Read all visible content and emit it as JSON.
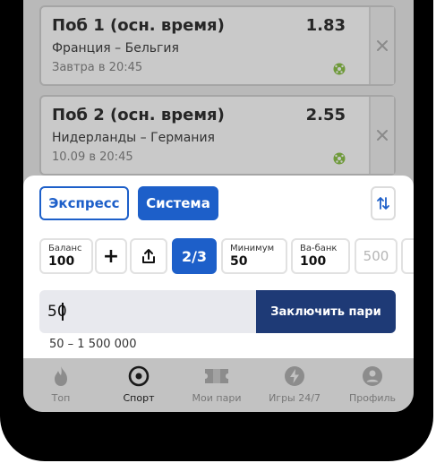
{
  "bets": [
    {
      "title": "Поб 1 (осн. время)",
      "odds": "1.83",
      "match": "Франция – Бельгия",
      "time": "Завтра в 20:45"
    },
    {
      "title": "Поб 2 (осн. время)",
      "odds": "2.55",
      "match": "Нидерланды – Германия",
      "time": "10.09 в 20:45"
    }
  ],
  "sheet": {
    "tabs": {
      "express": "Экспресс",
      "system": "Система"
    },
    "balance": {
      "label": "Баланс",
      "value": "100"
    },
    "system_option": "2/3",
    "minimum": {
      "label": "Минимум",
      "value": "50"
    },
    "vabank": {
      "label": "Ва-банк",
      "value": "100"
    },
    "preset": "500",
    "amount": {
      "value": "50"
    },
    "place_button": "Заключить пари",
    "range": "50 – 1 500 000"
  },
  "tabbar": {
    "items": [
      {
        "label": "Топ",
        "icon": "fire-icon"
      },
      {
        "label": "Спорт",
        "icon": "sport-icon"
      },
      {
        "label": "Мои пари",
        "icon": "ticket-icon"
      },
      {
        "label": "Игры 24/7",
        "icon": "lightning-icon"
      },
      {
        "label": "Профиль",
        "icon": "profile-icon"
      }
    ]
  },
  "colors": {
    "accent": "#1d5fc9",
    "place_button": "#1e3a76"
  }
}
